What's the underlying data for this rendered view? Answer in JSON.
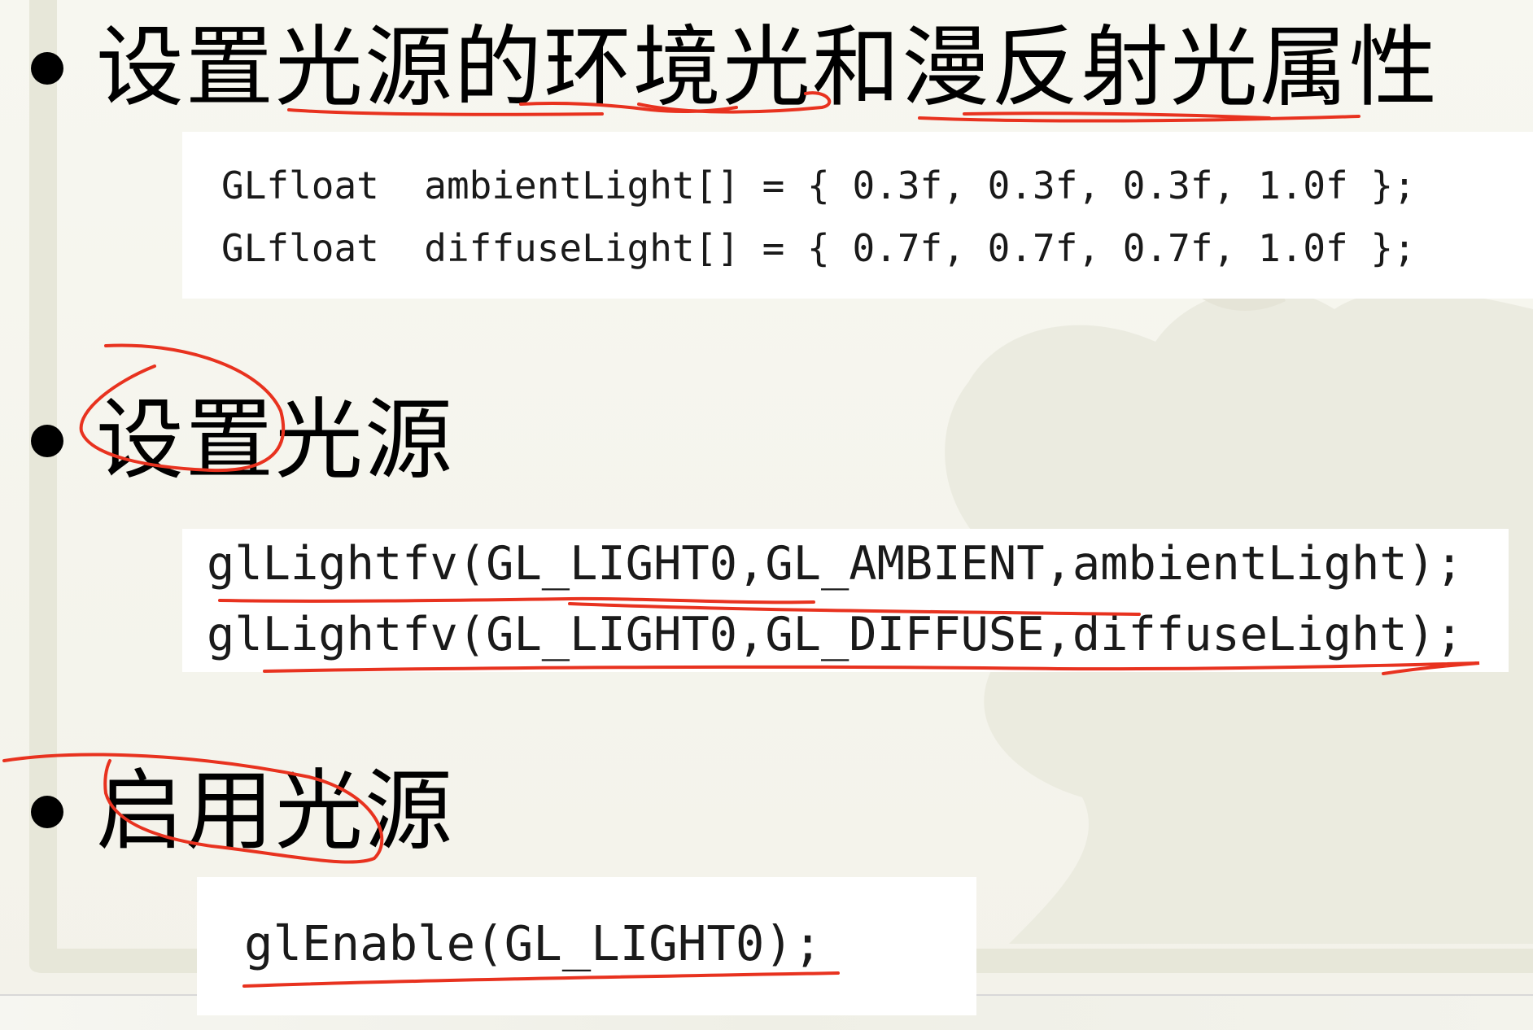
{
  "slide": {
    "bullets": [
      {
        "text": "设置光源的环境光和漫反射光属性"
      },
      {
        "text": "设置光源"
      },
      {
        "text": "启用光源"
      }
    ],
    "code_blocks": [
      {
        "lines": [
          "GLfloat  ambientLight[] = { 0.3f, 0.3f, 0.3f, 1.0f };",
          "GLfloat  diffuseLight[] = { 0.7f, 0.7f, 0.7f, 1.0f };"
        ]
      },
      {
        "lines": [
          "glLightfv(GL_LIGHT0,GL_AMBIENT,ambientLight);",
          "glLightfv(GL_LIGHT0,GL_DIFFUSE,diffuseLight);"
        ]
      },
      {
        "lines": [
          "glEnable(GL_LIGHT0);"
        ]
      }
    ]
  },
  "colors": {
    "annotation": "#e8321f",
    "background": "#f6f5ee",
    "code_bg": "#ffffff"
  }
}
